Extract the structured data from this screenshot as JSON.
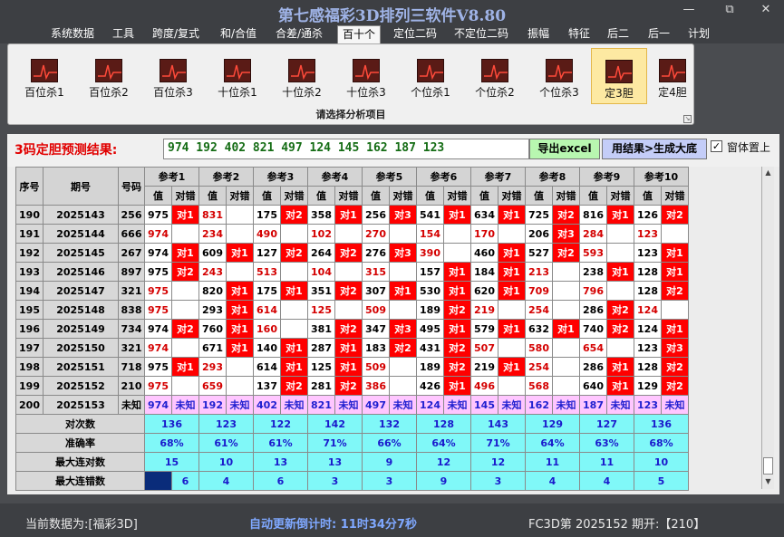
{
  "app": {
    "title": "第七感福彩3D排列三软件V8.80",
    "minimize": "—",
    "maximize": "⧉",
    "close": "✕"
  },
  "menu": [
    "系统数据",
    "工具",
    "跨度/复式",
    "和/合值",
    "合差/通杀",
    "百十个",
    "定位二码",
    "不定位二码",
    "振幅",
    "特征",
    "后二",
    "后一",
    "计划"
  ],
  "ribbon": {
    "buttons": [
      "百位杀1",
      "百位杀2",
      "百位杀3",
      "十位杀1",
      "十位杀2",
      "十位杀3",
      "个位杀1",
      "个位杀2",
      "个位杀3",
      "定3胆",
      "定4胆"
    ],
    "selected_index": 9,
    "caption": "请选择分析项目"
  },
  "prediction": {
    "label": "3码定胆预测结果:",
    "value": "974 192 402 821 497 124 145 162 187 123",
    "excel_button": "导出excel",
    "generate_button": "用结果>生成大底",
    "topmost_checked": true,
    "topmost_label": "窗体置上",
    "check_mark": "✓"
  },
  "table": {
    "col_seq": "序号",
    "col_period": "期号",
    "col_code": "号码",
    "ref_headers": [
      "参考1",
      "参考2",
      "参考3",
      "参考4",
      "参考5",
      "参考6",
      "参考7",
      "参考8",
      "参考9",
      "参考10"
    ],
    "sub_val": "值",
    "sub_res": "对错",
    "rows": [
      {
        "seq": "190",
        "period": "2025143",
        "code": "256",
        "cells": [
          [
            "975",
            "对1"
          ],
          [
            "831",
            ""
          ],
          [
            "175",
            "对2"
          ],
          [
            "358",
            "对1"
          ],
          [
            "256",
            "对3"
          ],
          [
            "541",
            "对1"
          ],
          [
            "634",
            "对1"
          ],
          [
            "725",
            "对2"
          ],
          [
            "816",
            "对1"
          ],
          [
            "126",
            "对2"
          ]
        ]
      },
      {
        "seq": "191",
        "period": "2025144",
        "code": "666",
        "cells": [
          [
            "974",
            ""
          ],
          [
            "234",
            ""
          ],
          [
            "490",
            ""
          ],
          [
            "102",
            ""
          ],
          [
            "270",
            ""
          ],
          [
            "154",
            ""
          ],
          [
            "170",
            ""
          ],
          [
            "206",
            "对3"
          ],
          [
            "284",
            ""
          ],
          [
            "123",
            ""
          ]
        ]
      },
      {
        "seq": "192",
        "period": "2025145",
        "code": "267",
        "cells": [
          [
            "974",
            "对1"
          ],
          [
            "609",
            "对1"
          ],
          [
            "127",
            "对2"
          ],
          [
            "264",
            "对2"
          ],
          [
            "276",
            "对3"
          ],
          [
            "390",
            ""
          ],
          [
            "460",
            "对1"
          ],
          [
            "527",
            "对2"
          ],
          [
            "593",
            ""
          ],
          [
            "123",
            "对1"
          ]
        ]
      },
      {
        "seq": "193",
        "period": "2025146",
        "code": "897",
        "cells": [
          [
            "975",
            "对2"
          ],
          [
            "243",
            ""
          ],
          [
            "513",
            ""
          ],
          [
            "104",
            ""
          ],
          [
            "315",
            ""
          ],
          [
            "157",
            "对1"
          ],
          [
            "184",
            "对1"
          ],
          [
            "213",
            ""
          ],
          [
            "238",
            "对1"
          ],
          [
            "128",
            "对1"
          ]
        ]
      },
      {
        "seq": "194",
        "period": "2025147",
        "code": "321",
        "cells": [
          [
            "975",
            ""
          ],
          [
            "820",
            "对1"
          ],
          [
            "175",
            "对1"
          ],
          [
            "351",
            "对2"
          ],
          [
            "307",
            "对1"
          ],
          [
            "530",
            "对1"
          ],
          [
            "620",
            "对1"
          ],
          [
            "709",
            ""
          ],
          [
            "796",
            ""
          ],
          [
            "128",
            "对2"
          ]
        ]
      },
      {
        "seq": "195",
        "period": "2025148",
        "code": "838",
        "cells": [
          [
            "975",
            ""
          ],
          [
            "293",
            "对1"
          ],
          [
            "614",
            ""
          ],
          [
            "125",
            ""
          ],
          [
            "509",
            ""
          ],
          [
            "189",
            "对2"
          ],
          [
            "219",
            ""
          ],
          [
            "254",
            ""
          ],
          [
            "286",
            "对2"
          ],
          [
            "124",
            ""
          ]
        ]
      },
      {
        "seq": "196",
        "period": "2025149",
        "code": "734",
        "cells": [
          [
            "974",
            "对2"
          ],
          [
            "760",
            "对1"
          ],
          [
            "160",
            ""
          ],
          [
            "381",
            "对2"
          ],
          [
            "347",
            "对3"
          ],
          [
            "495",
            "对1"
          ],
          [
            "579",
            "对1"
          ],
          [
            "632",
            "对1"
          ],
          [
            "740",
            "对2"
          ],
          [
            "124",
            "对1"
          ]
        ]
      },
      {
        "seq": "197",
        "period": "2025150",
        "code": "321",
        "cells": [
          [
            "974",
            ""
          ],
          [
            "671",
            "对1"
          ],
          [
            "140",
            "对1"
          ],
          [
            "287",
            "对1"
          ],
          [
            "183",
            "对2"
          ],
          [
            "431",
            "对2"
          ],
          [
            "507",
            ""
          ],
          [
            "580",
            ""
          ],
          [
            "654",
            ""
          ],
          [
            "123",
            "对3"
          ]
        ]
      },
      {
        "seq": "198",
        "period": "2025151",
        "code": "718",
        "cells": [
          [
            "975",
            "对1"
          ],
          [
            "293",
            ""
          ],
          [
            "614",
            "对1"
          ],
          [
            "125",
            "对1"
          ],
          [
            "509",
            ""
          ],
          [
            "189",
            "对2"
          ],
          [
            "219",
            "对1"
          ],
          [
            "254",
            ""
          ],
          [
            "286",
            "对1"
          ],
          [
            "128",
            "对2"
          ]
        ]
      },
      {
        "seq": "199",
        "period": "2025152",
        "code": "210",
        "cells": [
          [
            "975",
            ""
          ],
          [
            "659",
            ""
          ],
          [
            "137",
            "对2"
          ],
          [
            "281",
            "对2"
          ],
          [
            "386",
            ""
          ],
          [
            "426",
            "对1"
          ],
          [
            "496",
            ""
          ],
          [
            "568",
            ""
          ],
          [
            "640",
            "对1"
          ],
          [
            "129",
            "对2"
          ]
        ]
      }
    ],
    "future": {
      "seq": "200",
      "period": "2025153",
      "code": "未知",
      "values": [
        "974",
        "192",
        "402",
        "821",
        "497",
        "124",
        "145",
        "162",
        "187",
        "123"
      ],
      "res": "未知"
    },
    "stats": [
      {
        "label": "对次数",
        "values": [
          "136",
          "123",
          "122",
          "142",
          "132",
          "128",
          "143",
          "129",
          "127",
          "136"
        ]
      },
      {
        "label": "准确率",
        "values": [
          "68%",
          "61%",
          "61%",
          "71%",
          "66%",
          "64%",
          "71%",
          "64%",
          "63%",
          "68%"
        ]
      },
      {
        "label": "最大连对数",
        "values": [
          "15",
          "10",
          "13",
          "13",
          "9",
          "12",
          "12",
          "11",
          "11",
          "10"
        ]
      },
      {
        "label": "最大连错数",
        "values": [
          "6",
          "4",
          "6",
          "3",
          "3",
          "9",
          "3",
          "4",
          "4",
          "5"
        ]
      }
    ]
  },
  "status": {
    "data_label": "当前数据为:[福彩3D]",
    "countdown": "自动更新倒计时: 11时34分7秒",
    "period": "FC3D第 2025152 期开:【210】"
  }
}
